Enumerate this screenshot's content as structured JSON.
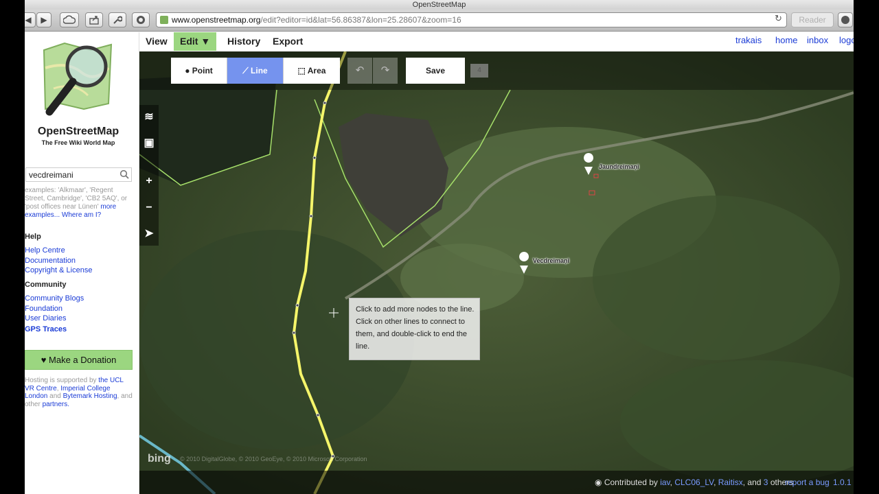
{
  "browser": {
    "window_title": "OpenStreetMap",
    "url_host": "www.openstreetmap.org",
    "url_path": "/edit?editor=id&lat=56.86387&lon=25.28607&zoom=16",
    "reader_label": "Reader"
  },
  "sidebar": {
    "site_title": "OpenStreetMap",
    "tagline": "The Free Wiki World Map",
    "search_value": "vecdreimani",
    "examples_text": "examples: 'Alkmaar', 'Regent Street, Cambridge', 'CB2 5AQ', or 'post offices near Lünen'",
    "more_examples_link": "more examples...",
    "where_am_i_link": "Where am I?",
    "help_heading": "Help",
    "help_links": [
      "Help Centre",
      "Documentation",
      "Copyright & License"
    ],
    "community_heading": "Community",
    "community_links": [
      "Community Blogs",
      "Foundation",
      "User Diaries",
      "GPS Traces"
    ],
    "donate_label": "Make a Donation",
    "hosting_prefix": "Hosting is supported by",
    "hosting_link1": "the UCL VR Centre",
    "hosting_sep": ",",
    "hosting_link2": "Imperial College London",
    "hosting_and": "and",
    "hosting_link3": "Bytemark Hosting",
    "hosting_and_other": ", and other",
    "hosting_link4": "partners."
  },
  "topnav": {
    "tabs": [
      "View",
      "Edit ▼",
      "History",
      "Export"
    ],
    "user_links": [
      "trakais",
      "home",
      "inbox",
      "logout"
    ]
  },
  "editor": {
    "modes": [
      "Point",
      "Line",
      "Area"
    ],
    "active_mode": "Line",
    "save_label": "Save",
    "edit_count": "4",
    "tooltip": "Click to add more nodes to the line. Click on other lines to connect to them, and double-click to end the line.",
    "map_labels": [
      "Jaundreimaņi",
      "Vecdreimaņi"
    ],
    "imagery_logo": "bing",
    "imagery_credit": "© 2010 DigitalGlobe, © 2010 GeoEye, © 2010 Microsoft Corporation",
    "footer": {
      "contributed_by": "Contributed by",
      "contributors": [
        "iav",
        "CLC06_LV",
        "Raitisx"
      ],
      "and_text": "and",
      "others_count": "3",
      "others_text": "others",
      "report_bug": "report a bug",
      "version": "1.0.1"
    }
  },
  "colors": {
    "edit_tab_green": "#9bd680",
    "line_mode_blue": "#7593ee",
    "link_blue": "#1a3bd6",
    "selected_line_yellow": "#f5f56a",
    "area_outline_green": "#a6e06a"
  }
}
